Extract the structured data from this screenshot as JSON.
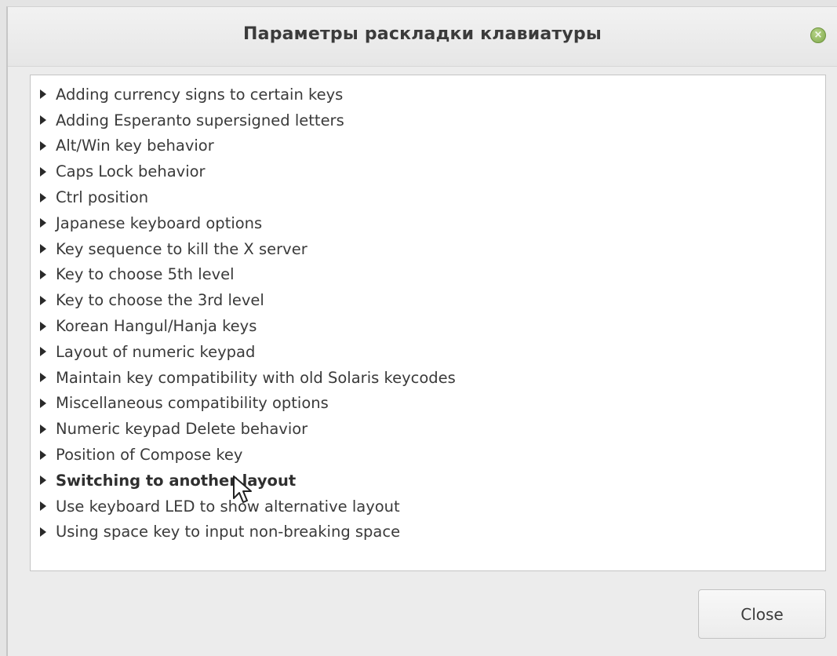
{
  "window": {
    "title": "Параметры раскладки клавиатуры",
    "close_icon": "×"
  },
  "options": {
    "items": [
      {
        "label": "Adding currency signs to certain keys",
        "bold": false
      },
      {
        "label": "Adding Esperanto supersigned letters",
        "bold": false
      },
      {
        "label": "Alt/Win key behavior",
        "bold": false
      },
      {
        "label": "Caps Lock behavior",
        "bold": false
      },
      {
        "label": "Ctrl position",
        "bold": false
      },
      {
        "label": "Japanese keyboard options",
        "bold": false
      },
      {
        "label": "Key sequence to kill the X server",
        "bold": false
      },
      {
        "label": "Key to choose 5th level",
        "bold": false
      },
      {
        "label": "Key to choose the 3rd level",
        "bold": false
      },
      {
        "label": "Korean Hangul/Hanja keys",
        "bold": false
      },
      {
        "label": "Layout of numeric keypad",
        "bold": false
      },
      {
        "label": "Maintain key compatibility with old Solaris keycodes",
        "bold": false
      },
      {
        "label": "Miscellaneous compatibility options",
        "bold": false
      },
      {
        "label": "Numeric keypad Delete behavior",
        "bold": false
      },
      {
        "label": "Position of Compose key",
        "bold": false
      },
      {
        "label": "Switching to another layout",
        "bold": true
      },
      {
        "label": "Use keyboard LED to show alternative layout",
        "bold": false
      },
      {
        "label": "Using space key to input non-breaking space",
        "bold": false
      }
    ]
  },
  "footer": {
    "close_label": "Close"
  },
  "colors": {
    "dialog_bg": "#ececec",
    "list_bg": "#ffffff",
    "close_icon_green": "#7fa94a"
  },
  "icons": {
    "expander": "triangle-right-icon",
    "window_close": "close-icon",
    "pointer": "mouse-cursor-icon"
  }
}
